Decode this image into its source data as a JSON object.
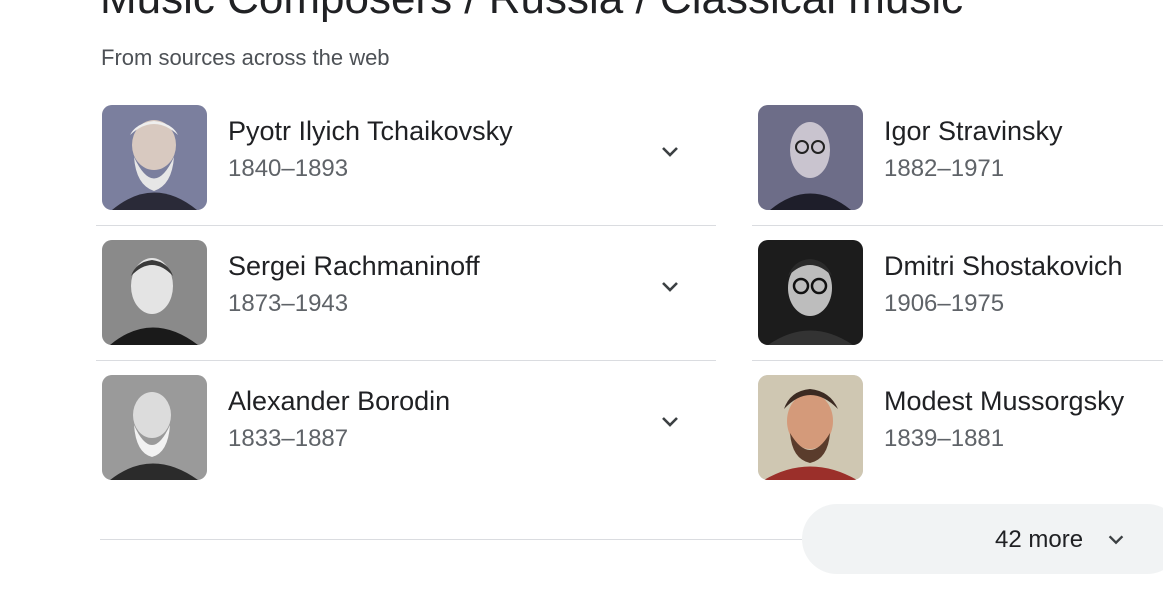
{
  "header": {
    "title": "Music Composers / Russia / Classical music",
    "subtitle": "From sources across the web"
  },
  "composers": [
    {
      "name": "Pyotr Ilyich Tchaikovsky",
      "years": "1840–1893",
      "image": "portrait-tchaikovsky"
    },
    {
      "name": "Igor Stravinsky",
      "years": "1882–1971",
      "image": "portrait-stravinsky"
    },
    {
      "name": "Sergei Rachmaninoff",
      "years": "1873–1943",
      "image": "portrait-rachmaninoff"
    },
    {
      "name": "Dmitri Shostakovich",
      "years": "1906–1975",
      "image": "portrait-shostakovich"
    },
    {
      "name": "Alexander Borodin",
      "years": "1833–1887",
      "image": "portrait-borodin"
    },
    {
      "name": "Modest Mussorgsky",
      "years": "1839–1881",
      "image": "portrait-mussorgsky"
    }
  ],
  "expand_icon": "chevron-down-icon",
  "more": {
    "label": "42 more",
    "icon": "chevron-down-icon"
  },
  "colors": {
    "text": "#202124",
    "secondary": "#5f6368",
    "divider": "#dadce0",
    "pill": "#f1f3f4"
  }
}
